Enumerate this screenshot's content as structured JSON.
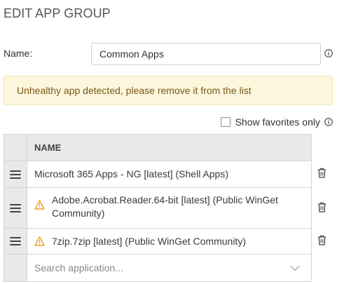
{
  "page": {
    "title": "EDIT APP GROUP"
  },
  "name_field": {
    "label": "Name:",
    "value": "Common Apps"
  },
  "alert": {
    "message": "Unhealthy app detected, please remove it from the list"
  },
  "favorites": {
    "label": "Show favorites only",
    "checked": false
  },
  "table": {
    "header": "NAME",
    "rows": [
      {
        "name": "Microsoft 365 Apps - NG [latest] (Shell Apps)",
        "warning": false
      },
      {
        "name": "Adobe.Acrobat.Reader.64-bit [latest] (Public WinGet Community)",
        "warning": true
      },
      {
        "name": "7zip.7zip [latest] (Public WinGet Community)",
        "warning": true
      }
    ],
    "search_placeholder": "Search application..."
  },
  "colors": {
    "alert_bg": "#fcf6dc",
    "alert_text": "#7a5a1c",
    "warning": "#f0a020",
    "header_bg": "#e9e9e9"
  }
}
